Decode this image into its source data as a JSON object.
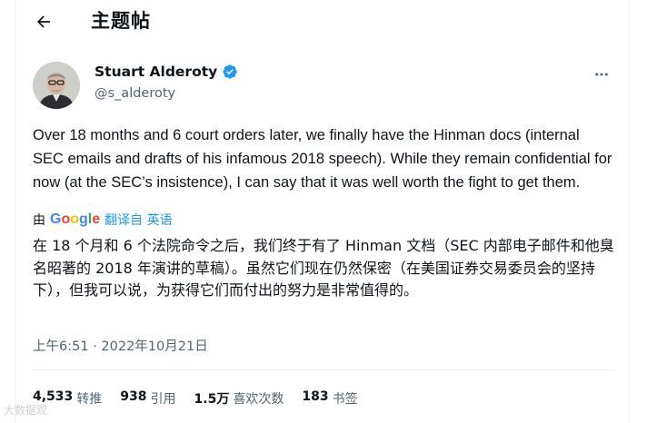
{
  "header": {
    "title": "主题帖"
  },
  "tweet": {
    "author_name": "Stuart Alderoty",
    "author_handle": "@s_alderoty",
    "text": "Over 18 months and 6 court orders later, we finally have the Hinman docs (internal SEC emails and drafts of his infamous 2018 speech). While they remain confidential for now (at the SEC’s insistence), I can say that it was well worth the fight to get them.",
    "by_label": "由",
    "google_label": "Google",
    "translate_label": "翻译自 英语",
    "translated_text": "在 18 个月和 6 个法院命令之后，我们终于有了 Hinman 文档（SEC 内部电子邮件和他臭名昭著的 2018 年演讲的草稿）。虽然它们现在仍然保密（在美国证券交易委员会的坚持下），但我可以说，为获得它们而付出的努力是非常值得的。",
    "timestamp": "上午6:51 · 2022年10月21日"
  },
  "stats": [
    {
      "value": "4,533",
      "label": "转推"
    },
    {
      "value": "938",
      "label": "引用"
    },
    {
      "value": "1.5万",
      "label": "喜欢次数"
    },
    {
      "value": "183",
      "label": "书签"
    }
  ],
  "watermark": "大数据观",
  "colors": {
    "accent": "#1d9bf0",
    "secondary_text": "#536471",
    "divider": "#eff3f4"
  }
}
